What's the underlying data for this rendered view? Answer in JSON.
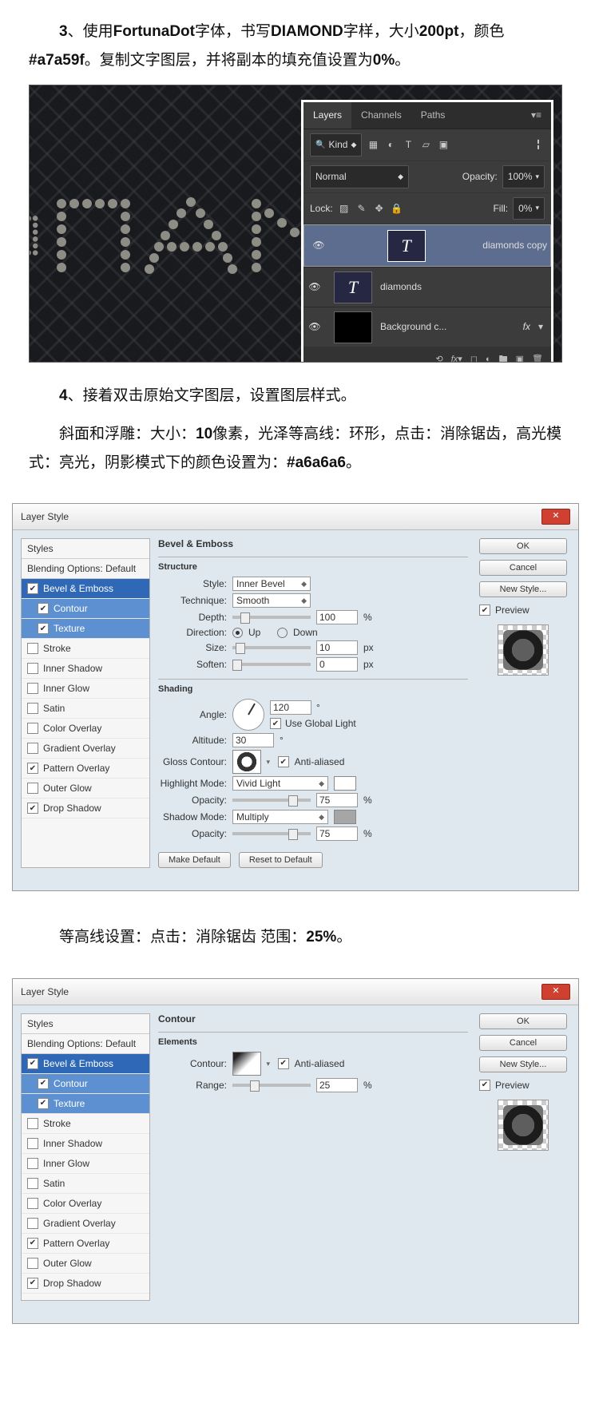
{
  "para1": {
    "pre": "　　",
    "n": "3",
    "t1": "、使用",
    "b1": "FortunaDot",
    "t2": "字体，书写",
    "b2": "DIAMOND",
    "t3": "字样，大小",
    "b3": "200pt",
    "t4": "，颜色",
    "b4": "#a7a59f",
    "t5": "。复制文字图层，并将副本的填充值设置为",
    "b5": "0%",
    "t6": "。"
  },
  "layers_panel": {
    "tabs": [
      "Layers",
      "Channels",
      "Paths"
    ],
    "kind": "Kind",
    "blend": "Normal",
    "opacity_label": "Opacity:",
    "opacity_val": "100%",
    "lock_label": "Lock:",
    "fill_label": "Fill:",
    "fill_val": "0%",
    "items": [
      {
        "name": "diamonds copy",
        "type": "T",
        "sel": true
      },
      {
        "name": "diamonds",
        "type": "T",
        "sel": false
      },
      {
        "name": "Background c...",
        "type": "bg",
        "fx": true
      }
    ]
  },
  "para2": {
    "pre": "　　",
    "n": "4",
    "t": "、接着双击原始文字图层，设置图层样式。"
  },
  "para3": {
    "pre": "　　斜面和浮雕：大小：",
    "b1": "10",
    "t1": "像素，光泽等高线：环形，点击：消除锯齿，高光模式：亮光，阴影模式下的颜色设置为：",
    "b2": "#a6a6a6",
    "t2": "。"
  },
  "ls_common": {
    "title": "Layer Style",
    "left": {
      "styles": "Styles",
      "blend": "Blending Options: Default",
      "items": [
        {
          "label": "Bevel & Emboss",
          "ck": true,
          "act": true
        },
        {
          "label": "Contour",
          "ck": true,
          "ind": true,
          "sub": true
        },
        {
          "label": "Texture",
          "ck": true,
          "ind": true,
          "sub": true
        },
        {
          "label": "Stroke",
          "ck": false
        },
        {
          "label": "Inner Shadow",
          "ck": false
        },
        {
          "label": "Inner Glow",
          "ck": false
        },
        {
          "label": "Satin",
          "ck": false
        },
        {
          "label": "Color Overlay",
          "ck": false
        },
        {
          "label": "Gradient Overlay",
          "ck": false
        },
        {
          "label": "Pattern Overlay",
          "ck": true
        },
        {
          "label": "Outer Glow",
          "ck": false
        },
        {
          "label": "Drop Shadow",
          "ck": true
        }
      ]
    },
    "right": {
      "ok": "OK",
      "cancel": "Cancel",
      "newstyle": "New Style...",
      "preview": "Preview"
    }
  },
  "bevel": {
    "h1": "Bevel & Emboss",
    "h2": "Structure",
    "style_l": "Style:",
    "style_v": "Inner Bevel",
    "tech_l": "Technique:",
    "tech_v": "Smooth",
    "depth_l": "Depth:",
    "depth_v": "100",
    "pct": "%",
    "dir_l": "Direction:",
    "up": "Up",
    "down": "Down",
    "size_l": "Size:",
    "size_v": "10",
    "px": "px",
    "soft_l": "Soften:",
    "soft_v": "0",
    "shading": "Shading",
    "angle_l": "Angle:",
    "angle_v": "120",
    "deg": "°",
    "ugl": "Use Global Light",
    "alt_l": "Altitude:",
    "alt_v": "30",
    "gloss_l": "Gloss Contour:",
    "aa": "Anti-aliased",
    "hl_l": "Highlight Mode:",
    "hl_v": "Vivid Light",
    "op_l": "Opacity:",
    "op1": "75",
    "sh_l": "Shadow Mode:",
    "sh_v": "Multiply",
    "op2": "75",
    "mkdef": "Make Default",
    "rstdef": "Reset to Default"
  },
  "para4": "　　等高线设置：点击：消除锯齿 范围：",
  "para4b": "25%",
  "para4t": "。",
  "contour": {
    "h1": "Contour",
    "h2": "Elements",
    "c_l": "Contour:",
    "aa": "Anti-aliased",
    "r_l": "Range:",
    "r_v": "25",
    "pct": "%"
  }
}
